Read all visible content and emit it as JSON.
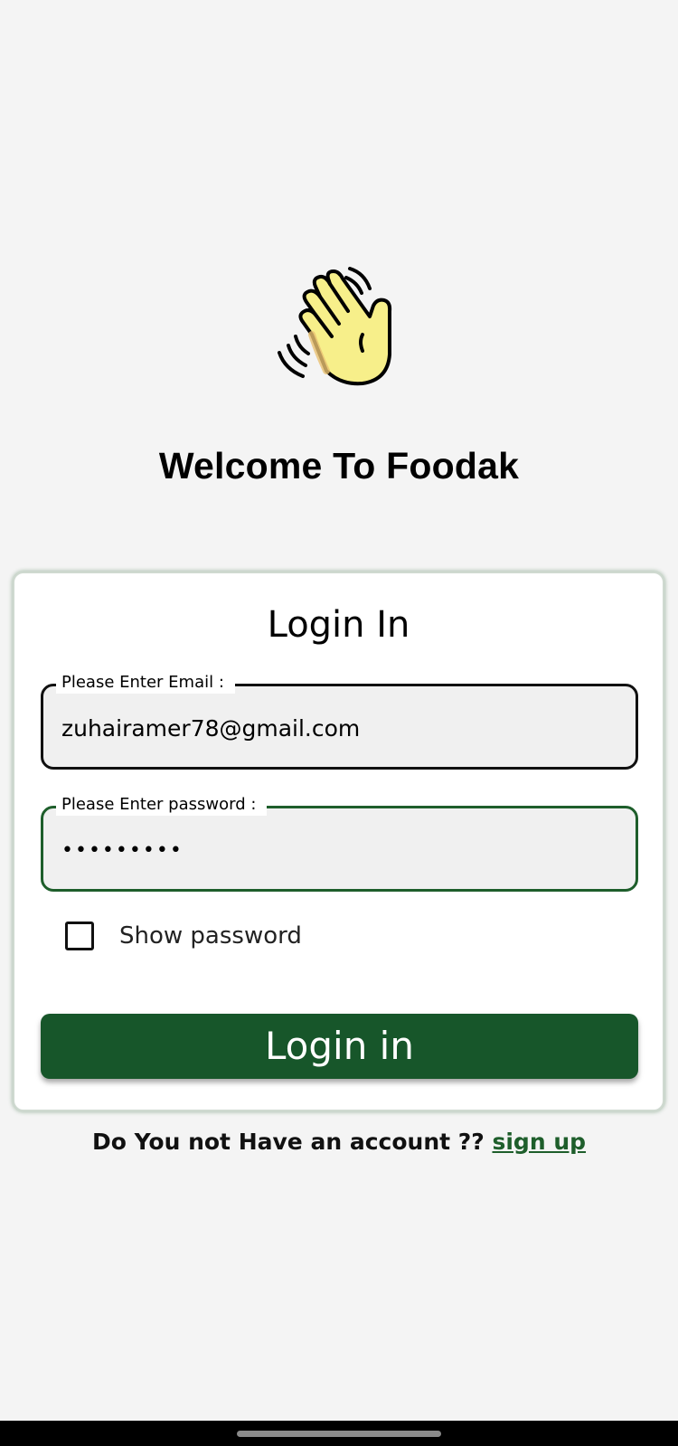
{
  "app": {
    "welcome_title": "Welcome To Foodak",
    "welcome_icon": "waving-hand-icon"
  },
  "login_card": {
    "title": "Login In",
    "email_field": {
      "label": "Please Enter Email :",
      "value": "zuhairamer78@gmail.com"
    },
    "password_field": {
      "label": "Please Enter password :",
      "value": "•••••••••"
    },
    "show_password": {
      "label": "Show password",
      "checked": false
    },
    "submit_label": "Login in"
  },
  "signup": {
    "prompt": "Do You not Have an account ?? ",
    "link_label": "sign up"
  },
  "colors": {
    "accent": "#17562a",
    "focus_border": "#1e5e2b",
    "background": "#f4f4f4"
  }
}
